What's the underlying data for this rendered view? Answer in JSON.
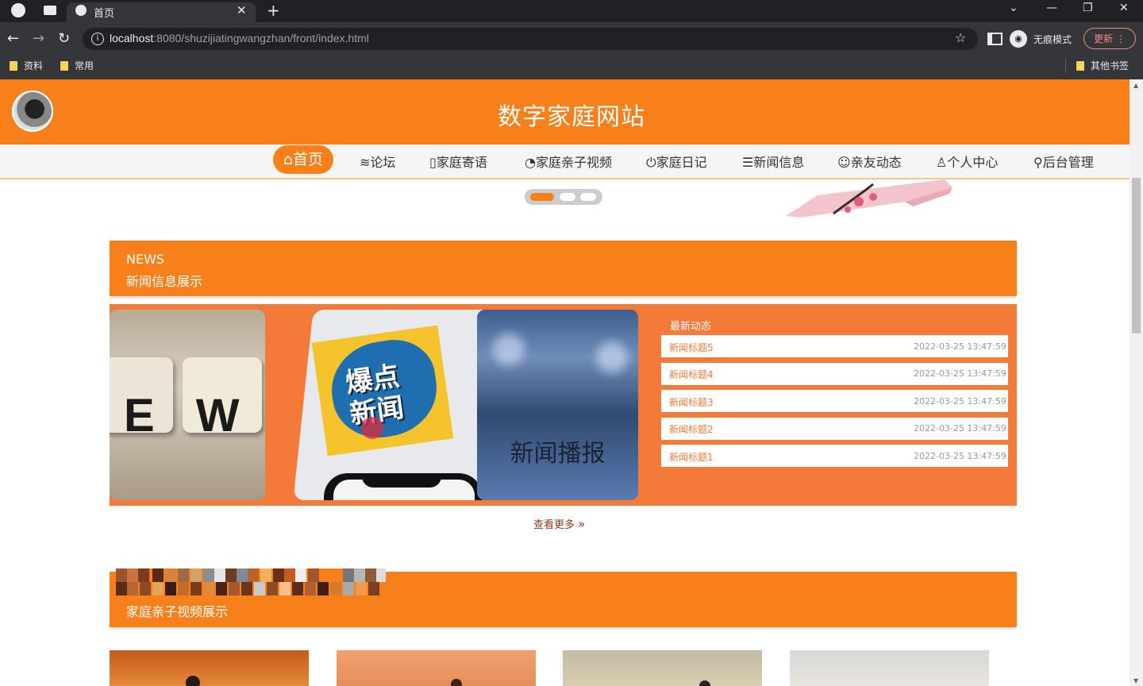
{
  "browser": {
    "tab_title": "首页",
    "url_host": "localhost",
    "url_rest": ":8080/shuzijiatingwangzhan/front/index.html",
    "incognito_label": "无痕模式",
    "update_label": "更新",
    "bookmarks": [
      "资料",
      "常用"
    ],
    "other_bookmarks": "其他书签"
  },
  "site": {
    "title": "数字家庭网站",
    "nav": [
      {
        "label": "首页",
        "icon": "home-icon"
      },
      {
        "label": "论坛",
        "icon": "layers-icon"
      },
      {
        "label": "家庭寄语",
        "icon": "book-icon"
      },
      {
        "label": "家庭亲子视频",
        "icon": "palette-icon"
      },
      {
        "label": "家庭日记",
        "icon": "power-icon"
      },
      {
        "label": "新闻信息",
        "icon": "sliders-icon"
      },
      {
        "label": "亲友动态",
        "icon": "smile-icon"
      },
      {
        "label": "个人中心",
        "icon": "user-icon"
      },
      {
        "label": "后台管理",
        "icon": "link-icon"
      }
    ],
    "colors": {
      "accent": "#f8801a",
      "panel": "#f47a3a"
    }
  },
  "news_section": {
    "en": "NEWS",
    "cn": "新闻信息展示",
    "image_texts": {
      "img1": "E W",
      "img2": "爆点新闻",
      "img3": "新闻播报"
    },
    "latest_title": "最新动态",
    "items": [
      {
        "title": "新闻标题5",
        "date": "2022-03-25 13:47:59"
      },
      {
        "title": "新闻标题4",
        "date": "2022-03-25 13:47:59"
      },
      {
        "title": "新闻标题3",
        "date": "2022-03-25 13:47:59"
      },
      {
        "title": "新闻标题2",
        "date": "2022-03-25 13:47:59"
      },
      {
        "title": "新闻标题1",
        "date": "2022-03-25 13:47:59"
      }
    ],
    "more_label": "查看更多"
  },
  "video_section": {
    "cn": "家庭亲子视频展示"
  }
}
